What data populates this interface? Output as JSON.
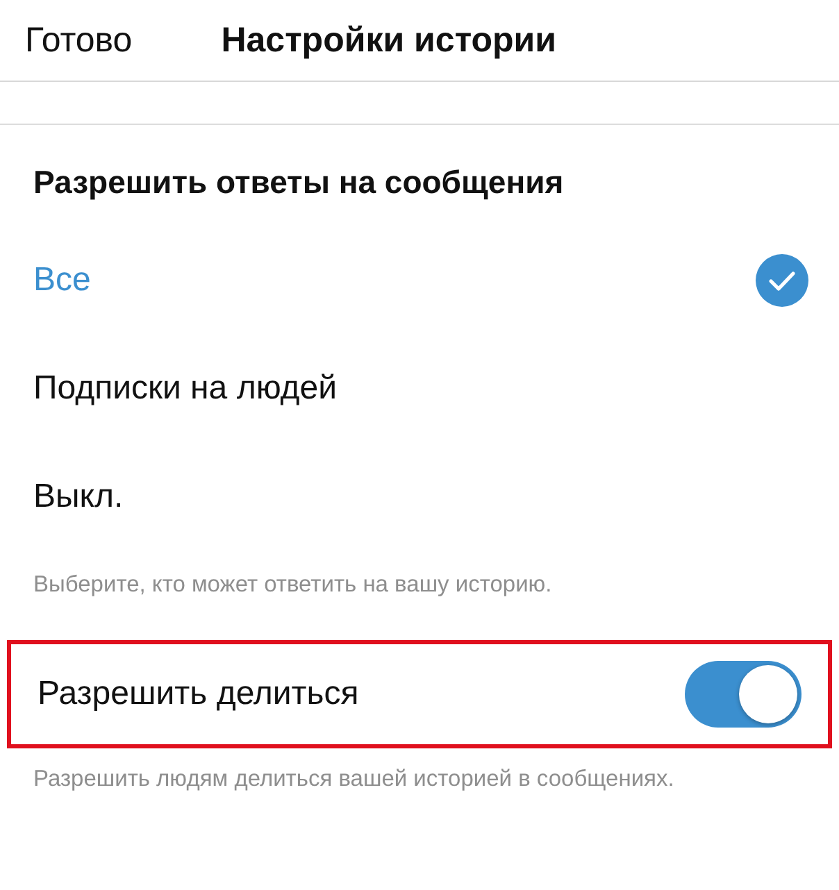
{
  "header": {
    "done": "Готово",
    "title": "Настройки истории"
  },
  "replies": {
    "heading": "Разрешить ответы на сообщения",
    "options": [
      {
        "label": "Все",
        "selected": true
      },
      {
        "label": "Подписки на людей",
        "selected": false
      },
      {
        "label": "Выкл.",
        "selected": false
      }
    ],
    "hint": "Выберите, кто может ответить на вашу историю."
  },
  "sharing": {
    "label": "Разрешить делиться",
    "on": true,
    "highlighted": true,
    "hint": "Разрешить людям делиться вашей историей в сообщениях."
  }
}
